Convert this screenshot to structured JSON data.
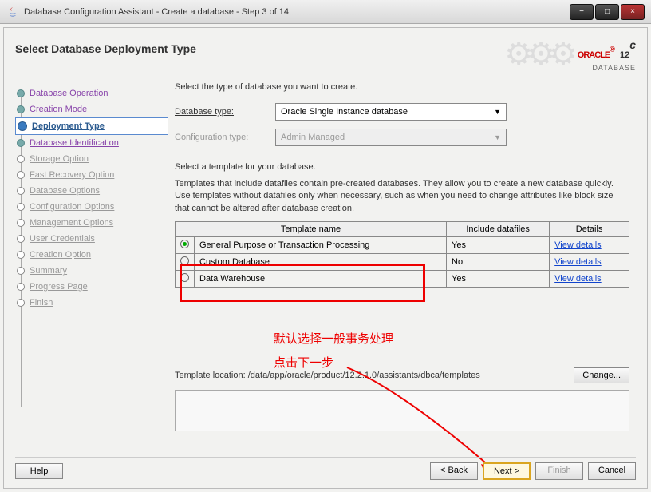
{
  "titlebar": {
    "title": "Database Configuration Assistant - Create a database - Step 3 of 14"
  },
  "header": {
    "page_title": "Select Database Deployment Type",
    "oracle_brand": "ORACLE",
    "oracle_sub": "DATABASE",
    "oracle_version": "12",
    "oracle_version_sup": "c"
  },
  "sidebar": {
    "steps": [
      "Database Operation",
      "Creation Mode",
      "Deployment Type",
      "Database Identification",
      "Storage Option",
      "Fast Recovery Option",
      "Database Options",
      "Configuration Options",
      "Management Options",
      "User Credentials",
      "Creation Option",
      "Summary",
      "Progress Page",
      "Finish"
    ]
  },
  "main": {
    "instruction": "Select the type of database you want to create.",
    "db_type_label": "Database type:",
    "db_type_value": "Oracle Single Instance database",
    "config_type_label": "Configuration type:",
    "config_type_value": "Admin Managed",
    "template_section": "Select a template for your database.",
    "template_desc": "Templates that include datafiles contain pre-created databases. They allow you to create a new database quickly. Use templates without datafiles only when necessary, such as when you need to change attributes like block size that cannot be altered after database creation.",
    "table": {
      "col1": "Template name",
      "col2": "Include datafiles",
      "col3": "Details",
      "rows": [
        {
          "name": "General Purpose or Transaction Processing",
          "include": "Yes",
          "details": "View details"
        },
        {
          "name": "Custom Database",
          "include": "No",
          "details": "View details"
        },
        {
          "name": "Data Warehouse",
          "include": "Yes",
          "details": "View details"
        }
      ]
    },
    "location_label": "Template location: /data/app/oracle/product/12.2.1.0/assistants/dbca/templates",
    "change_btn": "Change..."
  },
  "annotations": {
    "line1": "默认选择一般事务处理",
    "line2": "点击下一步"
  },
  "footer": {
    "help": "Help",
    "back": "< Back",
    "next": "Next >",
    "finish": "Finish",
    "cancel": "Cancel"
  }
}
